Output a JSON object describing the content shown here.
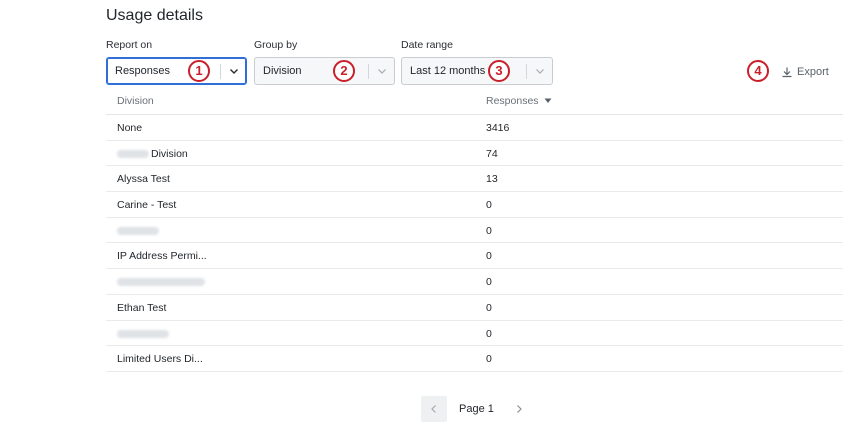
{
  "title": "Usage details",
  "filters": {
    "report_on": {
      "label": "Report on",
      "value": "Responses",
      "step": "1"
    },
    "group_by": {
      "label": "Group by",
      "value": "Division",
      "step": "2"
    },
    "date_range": {
      "label": "Date range",
      "value": "Last 12 months",
      "step": "3"
    }
  },
  "export": {
    "label": "Export",
    "step": "4"
  },
  "table": {
    "headers": [
      "Division",
      "Responses"
    ],
    "rows": [
      {
        "name": "None",
        "value": "3416"
      },
      {
        "name": "Division",
        "value": "74"
      },
      {
        "name": "Alyssa Test",
        "value": "13"
      },
      {
        "name": "Carine - Test",
        "value": "0"
      },
      {
        "name": "",
        "value": "0"
      },
      {
        "name": "IP Address Permi...",
        "value": "0"
      },
      {
        "name": "",
        "value": "0"
      },
      {
        "name": "Ethan Test",
        "value": "0"
      },
      {
        "name": "",
        "value": "0"
      },
      {
        "name": "Limited Users Di...",
        "value": "0"
      }
    ]
  },
  "pagination": {
    "label": "Page 1"
  },
  "colors": {
    "accent": "#2f6fd6",
    "step_marker": "#c8202b"
  }
}
